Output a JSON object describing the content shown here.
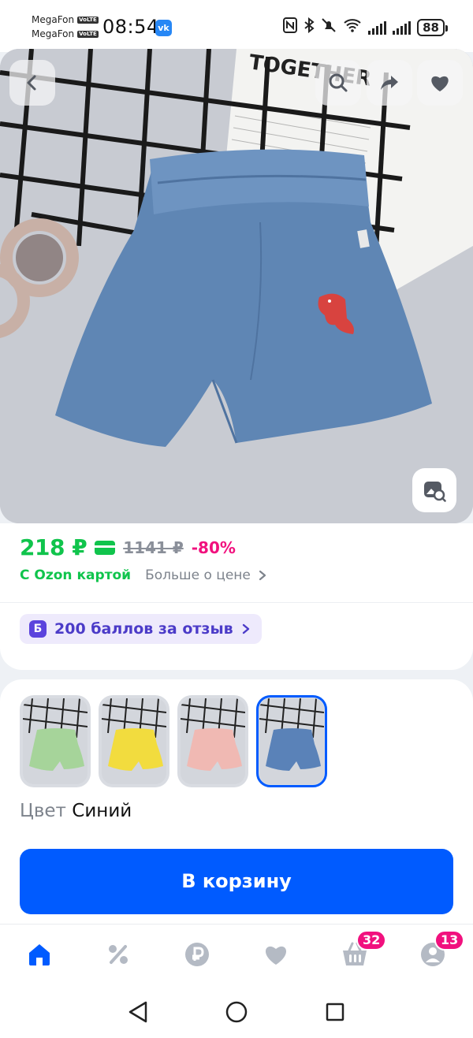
{
  "status_bar": {
    "carrier_1": "MegaFon",
    "carrier_2": "MegaFon",
    "volte": "VoLTE",
    "time": "08:54",
    "vk_label": "vk",
    "battery": "88"
  },
  "product": {
    "image_alt_words": "TOGETHER",
    "price_current": "218 ₽",
    "price_old": "1141 ₽",
    "discount": "-80%",
    "ozon_card_label": "С Ozon картой",
    "more_price_label": "Больше о цене",
    "points_icon_letter": "Б",
    "points_label": "200 баллов за отзыв"
  },
  "variants": {
    "items": [
      {
        "color": "#a6d49a",
        "name": "green"
      },
      {
        "color": "#f2dc3e",
        "name": "yellow"
      },
      {
        "color": "#f0b9b3",
        "name": "pink"
      },
      {
        "color": "#5a82b8",
        "name": "blue"
      }
    ],
    "selected_index": 3,
    "color_key": "Цвет",
    "color_value": "Синий"
  },
  "cart_button": {
    "label": "В корзину"
  },
  "bottom_nav": {
    "items": [
      {
        "name": "home-icon",
        "badge": ""
      },
      {
        "name": "percent-icon",
        "badge": ""
      },
      {
        "name": "ruble-icon",
        "badge": ""
      },
      {
        "name": "heart-icon",
        "badge": ""
      },
      {
        "name": "cart-icon",
        "badge": "32"
      },
      {
        "name": "profile-icon",
        "badge": "13"
      }
    ],
    "active_color": "#005bff",
    "inactive_color": "#b4bac4"
  },
  "colors": {
    "price_green": "#10c44c",
    "discount_pink": "#f1117e",
    "primary_blue": "#005bff",
    "points_purple": "#5b43dd"
  }
}
